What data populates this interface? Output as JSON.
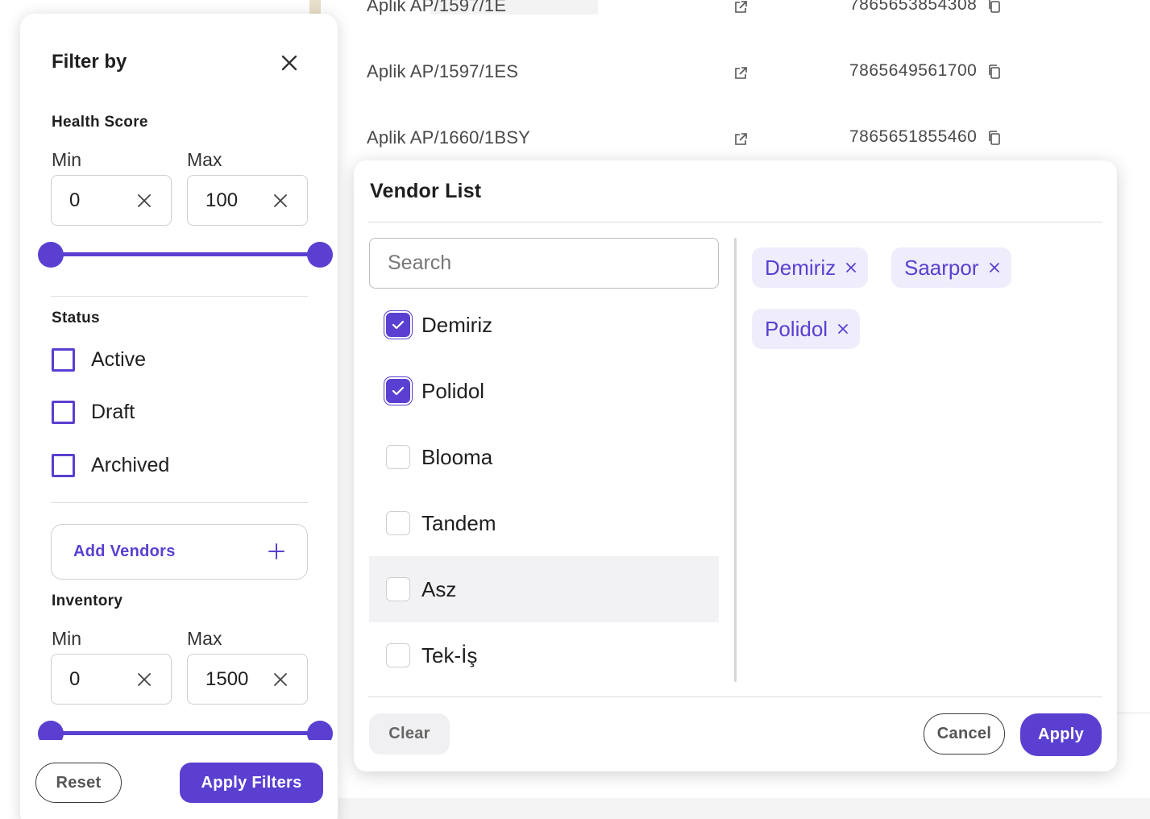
{
  "background_table": {
    "rows": [
      {
        "name": "Aplik AP/1597/1E",
        "id": "7865653854308"
      },
      {
        "name": "Aplik AP/1597/1ES",
        "id": "7865649561700"
      },
      {
        "name": "Aplik AP/1660/1BSY",
        "id": "7865651855460"
      }
    ]
  },
  "filter_panel": {
    "title": "Filter by",
    "health_score": {
      "label": "Health Score",
      "min_label": "Min",
      "max_label": "Max",
      "min_value": "0",
      "max_value": "100"
    },
    "status": {
      "label": "Status",
      "options": [
        {
          "label": "Active",
          "checked": false
        },
        {
          "label": "Draft",
          "checked": false
        },
        {
          "label": "Archived",
          "checked": false
        }
      ]
    },
    "add_vendors_label": "Add Vendors",
    "inventory": {
      "label": "Inventory",
      "min_label": "Min",
      "max_label": "Max",
      "min_value": "0",
      "max_value": "1500"
    },
    "reset_label": "Reset",
    "apply_label": "Apply Filters"
  },
  "vendor_modal": {
    "title": "Vendor List",
    "search_placeholder": "Search",
    "vendors": [
      {
        "label": "Demiriz",
        "checked": true
      },
      {
        "label": "Polidol",
        "checked": true
      },
      {
        "label": "Blooma",
        "checked": false
      },
      {
        "label": "Tandem",
        "checked": false
      },
      {
        "label": "Asz",
        "checked": false
      },
      {
        "label": "Tek-İş",
        "checked": false
      }
    ],
    "selected_chips": [
      "Demiriz",
      "Saarpor",
      "Polidol"
    ],
    "clear_label": "Clear",
    "cancel_label": "Cancel",
    "apply_label": "Apply"
  },
  "colors": {
    "accent": "#5b3fd1",
    "chip_bg": "#efedfb"
  }
}
